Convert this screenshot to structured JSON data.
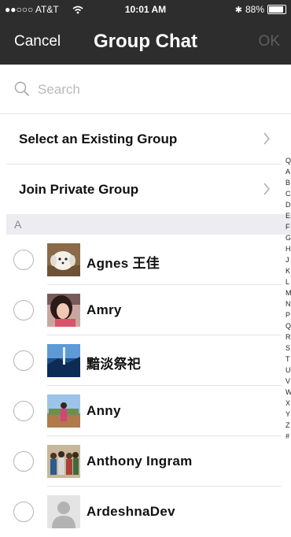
{
  "status_bar": {
    "carrier": "●●○○○ AT&T",
    "time": "10:01 AM",
    "battery": "88%",
    "battery_level": 0.88
  },
  "nav": {
    "cancel": "Cancel",
    "title": "Group Chat",
    "ok": "OK"
  },
  "search": {
    "placeholder": "Search"
  },
  "menu": [
    {
      "label": "Select an Existing Group"
    },
    {
      "label": "Join Private Group"
    }
  ],
  "section_header": "A",
  "contacts": [
    {
      "name": "Agnes 王佳",
      "avatar": "dog-photo"
    },
    {
      "name": "Amry",
      "avatar": "woman-photo"
    },
    {
      "name": "黯淡祭祀",
      "avatar": "blue-landscape-photo"
    },
    {
      "name": "Anny",
      "avatar": "outdoor-photo"
    },
    {
      "name": "Anthony Ingram",
      "avatar": "group-photo"
    },
    {
      "name": "ArdeshnaDev",
      "avatar": "default-person-icon"
    }
  ],
  "index_letters": [
    "Q",
    "A",
    "B",
    "C",
    "D",
    "E",
    "F",
    "G",
    "H",
    "J",
    "K",
    "L",
    "M",
    "N",
    "P",
    "Q",
    "R",
    "S",
    "T",
    "U",
    "V",
    "W",
    "X",
    "Y",
    "Z",
    "#"
  ],
  "colors": {
    "nav_background": "#2d2d2d",
    "ok_disabled": "#5e5e5e",
    "section_background": "#ececf1"
  }
}
